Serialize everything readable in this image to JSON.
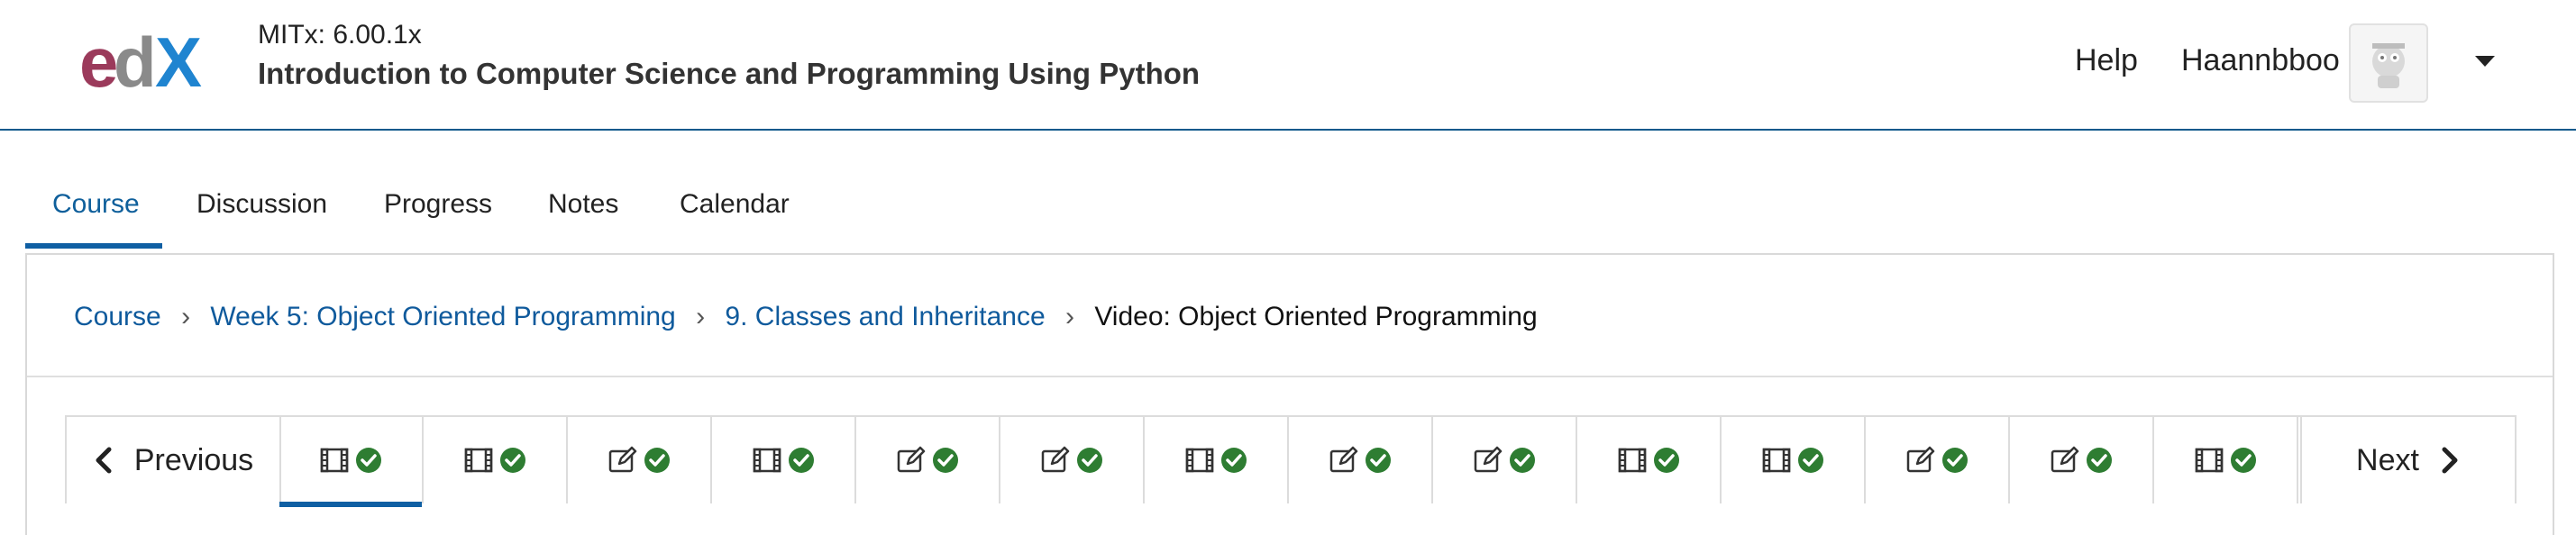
{
  "header": {
    "logo_text": "edX",
    "course_org": "MITx: 6.00.1x",
    "course_title": "Introduction to Computer Science and Programming Using Python",
    "help_label": "Help",
    "username": "Haannbboo",
    "colors": {
      "accent": "#0f5a9c",
      "logo_e": "#9b3a5b",
      "logo_d": "#8a8a8a",
      "logo_x": "#1f84d0"
    }
  },
  "tabs": [
    {
      "label": "Course",
      "active": true
    },
    {
      "label": "Discussion",
      "active": false
    },
    {
      "label": "Progress",
      "active": false
    },
    {
      "label": "Notes",
      "active": false
    },
    {
      "label": "Calendar",
      "active": false
    }
  ],
  "breadcrumb": {
    "items": [
      "Course",
      "Week 5: Object Oriented Programming",
      "9. Classes and Inheritance"
    ],
    "current": "Video: Object Oriented Programming"
  },
  "sequence": {
    "previous_label": "Previous",
    "next_label": "Next",
    "items": [
      {
        "type": "video",
        "icon": "video-icon",
        "completed": true,
        "active": true
      },
      {
        "type": "video",
        "icon": "video-icon",
        "completed": true,
        "active": false
      },
      {
        "type": "problem",
        "icon": "edit-icon",
        "completed": true,
        "active": false
      },
      {
        "type": "video",
        "icon": "video-icon",
        "completed": true,
        "active": false
      },
      {
        "type": "problem",
        "icon": "edit-icon",
        "completed": true,
        "active": false
      },
      {
        "type": "problem",
        "icon": "edit-icon",
        "completed": true,
        "active": false
      },
      {
        "type": "video",
        "icon": "video-icon",
        "completed": true,
        "active": false
      },
      {
        "type": "problem",
        "icon": "edit-icon",
        "completed": true,
        "active": false
      },
      {
        "type": "problem",
        "icon": "edit-icon",
        "completed": true,
        "active": false
      },
      {
        "type": "video",
        "icon": "video-icon",
        "completed": true,
        "active": false
      },
      {
        "type": "video",
        "icon": "video-icon",
        "completed": true,
        "active": false
      },
      {
        "type": "problem",
        "icon": "edit-icon",
        "completed": true,
        "active": false
      },
      {
        "type": "problem",
        "icon": "edit-icon",
        "completed": true,
        "active": false
      },
      {
        "type": "video",
        "icon": "video-icon",
        "completed": true,
        "active": false
      }
    ]
  }
}
